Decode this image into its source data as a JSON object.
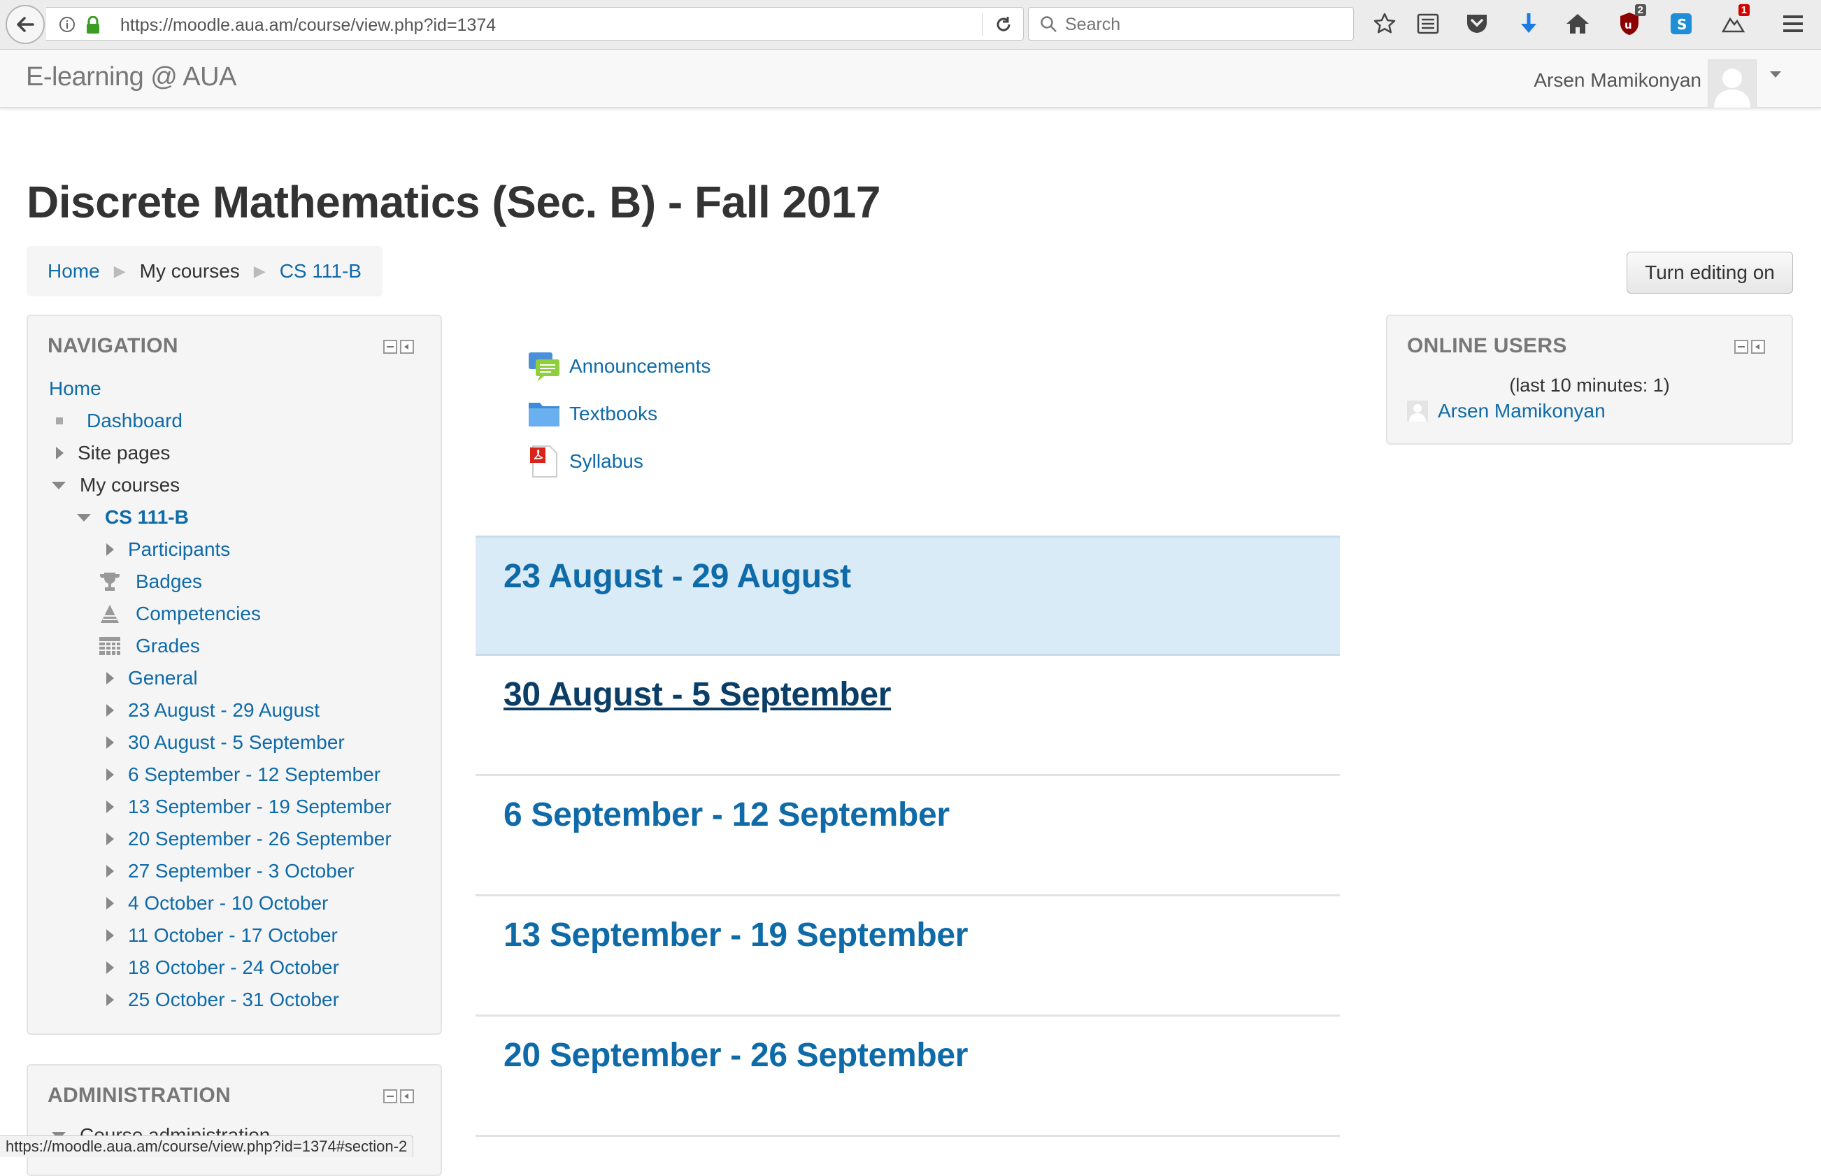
{
  "browser": {
    "url": "https://moodle.aua.am/course/view.php?id=1374",
    "search_placeholder": "Search",
    "pocket_badge": "2",
    "ext_badge": "1",
    "status_url": "https://moodle.aua.am/course/view.php?id=1374#section-2"
  },
  "header": {
    "site_name": "E-learning @ AUA",
    "user_name": "Arsen Mamikonyan"
  },
  "page": {
    "title": "Discrete Mathematics (Sec. B) - Fall 2017",
    "edit_button": "Turn editing on"
  },
  "breadcrumb": [
    "Home",
    "My courses",
    "CS 111-B"
  ],
  "navigation": {
    "title": "NAVIGATION",
    "home": "Home",
    "dashboard": "Dashboard",
    "site_pages": "Site pages",
    "my_courses": "My courses",
    "course": "CS 111-B",
    "participants": "Participants",
    "badges": "Badges",
    "competencies": "Competencies",
    "grades": "Grades",
    "general": "General",
    "weeks": [
      "23 August - 29 August",
      "30 August - 5 September",
      "6 September - 12 September",
      "13 September - 19 September",
      "20 September - 26 September",
      "27 September - 3 October",
      "4 October - 10 October",
      "11 October - 17 October",
      "18 October - 24 October",
      "25 October - 31 October"
    ]
  },
  "administration": {
    "title": "ADMINISTRATION",
    "first_item": "Course administration"
  },
  "online_users": {
    "title": "ONLINE USERS",
    "subtitle": "(last 10 minutes: 1)",
    "users": [
      "Arsen Mamikonyan"
    ]
  },
  "activities": [
    {
      "name": "Announcements",
      "icon": "forum-icon"
    },
    {
      "name": "Textbooks",
      "icon": "folder-icon"
    },
    {
      "name": "Syllabus",
      "icon": "pdf-icon"
    }
  ],
  "sections": [
    "23 August - 29 August",
    "30 August - 5 September",
    "6 September - 12 September",
    "13 September - 19 September",
    "20 September - 26 September"
  ],
  "colors": {
    "link": "#0f6aa8",
    "current_section_bg": "#d9ebf7"
  }
}
